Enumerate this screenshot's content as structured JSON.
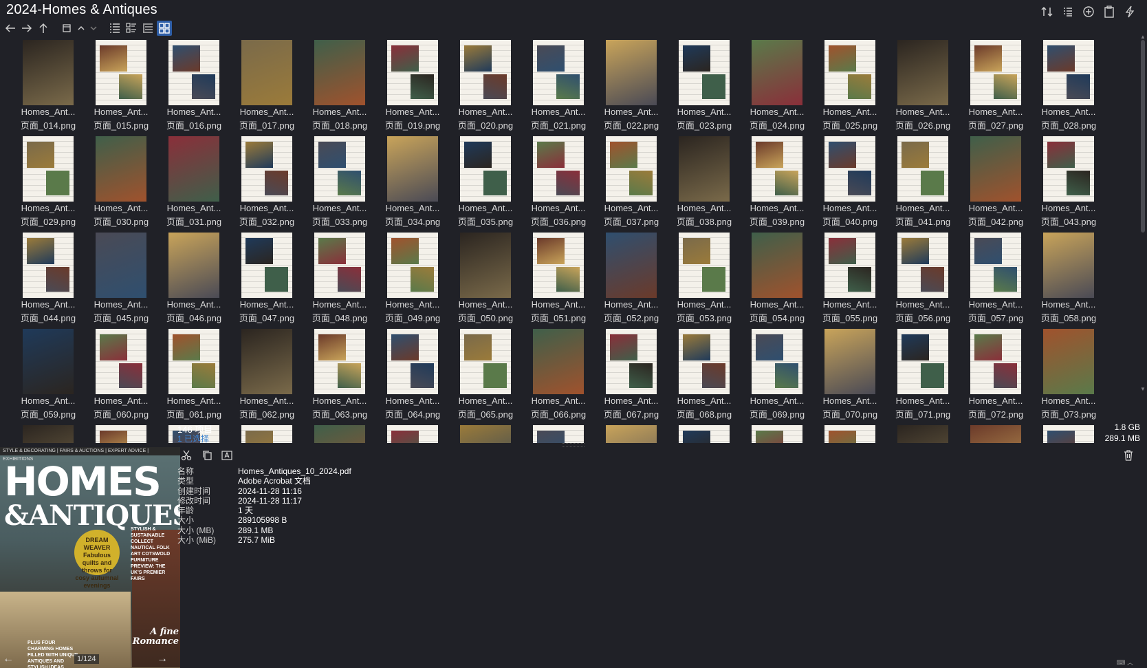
{
  "window": {
    "title": "2024-Homes & Antiques"
  },
  "top_actions": [
    {
      "name": "sort-icon"
    },
    {
      "name": "view-list-icon"
    },
    {
      "name": "add-icon"
    },
    {
      "name": "clipboard-icon"
    },
    {
      "name": "lightning-icon"
    }
  ],
  "toolbar": [
    {
      "name": "back-icon"
    },
    {
      "name": "forward-icon"
    },
    {
      "name": "up-icon"
    },
    {
      "name": "folder-icon"
    },
    {
      "name": "chevron-up-icon"
    },
    {
      "name": "chevron-down-icon"
    },
    {
      "name": "details-view-icon"
    },
    {
      "name": "tiles-view-icon"
    },
    {
      "name": "tree-view-icon"
    },
    {
      "name": "thumbnails-view-icon",
      "active": true
    }
  ],
  "files": [
    {
      "name": "Homes_Ant...",
      "page": "页面_014.png"
    },
    {
      "name": "Homes_Ant...",
      "page": "页面_015.png"
    },
    {
      "name": "Homes_Ant...",
      "page": "页面_016.png"
    },
    {
      "name": "Homes_Ant...",
      "page": "页面_017.png"
    },
    {
      "name": "Homes_Ant...",
      "page": "页面_018.png"
    },
    {
      "name": "Homes_Ant...",
      "page": "页面_019.png"
    },
    {
      "name": "Homes_Ant...",
      "page": "页面_020.png"
    },
    {
      "name": "Homes_Ant...",
      "page": "页面_021.png"
    },
    {
      "name": "Homes_Ant...",
      "page": "页面_022.png"
    },
    {
      "name": "Homes_Ant...",
      "page": "页面_023.png"
    },
    {
      "name": "Homes_Ant...",
      "page": "页面_024.png"
    },
    {
      "name": "Homes_Ant...",
      "page": "页面_025.png"
    },
    {
      "name": "Homes_Ant...",
      "page": "页面_026.png"
    },
    {
      "name": "Homes_Ant...",
      "page": "页面_027.png"
    },
    {
      "name": "Homes_Ant...",
      "page": "页面_028.png"
    },
    {
      "name": "Homes_Ant...",
      "page": "页面_029.png"
    },
    {
      "name": "Homes_Ant...",
      "page": "页面_030.png"
    },
    {
      "name": "Homes_Ant...",
      "page": "页面_031.png"
    },
    {
      "name": "Homes_Ant...",
      "page": "页面_032.png"
    },
    {
      "name": "Homes_Ant...",
      "page": "页面_033.png"
    },
    {
      "name": "Homes_Ant...",
      "page": "页面_034.png"
    },
    {
      "name": "Homes_Ant...",
      "page": "页面_035.png"
    },
    {
      "name": "Homes_Ant...",
      "page": "页面_036.png"
    },
    {
      "name": "Homes_Ant...",
      "page": "页面_037.png"
    },
    {
      "name": "Homes_Ant...",
      "page": "页面_038.png"
    },
    {
      "name": "Homes_Ant...",
      "page": "页面_039.png"
    },
    {
      "name": "Homes_Ant...",
      "page": "页面_040.png"
    },
    {
      "name": "Homes_Ant...",
      "page": "页面_041.png"
    },
    {
      "name": "Homes_Ant...",
      "page": "页面_042.png"
    },
    {
      "name": "Homes_Ant...",
      "page": "页面_043.png"
    },
    {
      "name": "Homes_Ant...",
      "page": "页面_044.png"
    },
    {
      "name": "Homes_Ant...",
      "page": "页面_045.png"
    },
    {
      "name": "Homes_Ant...",
      "page": "页面_046.png"
    },
    {
      "name": "Homes_Ant...",
      "page": "页面_047.png"
    },
    {
      "name": "Homes_Ant...",
      "page": "页面_048.png"
    },
    {
      "name": "Homes_Ant...",
      "page": "页面_049.png"
    },
    {
      "name": "Homes_Ant...",
      "page": "页面_050.png"
    },
    {
      "name": "Homes_Ant...",
      "page": "页面_051.png"
    },
    {
      "name": "Homes_Ant...",
      "page": "页面_052.png"
    },
    {
      "name": "Homes_Ant...",
      "page": "页面_053.png"
    },
    {
      "name": "Homes_Ant...",
      "page": "页面_054.png"
    },
    {
      "name": "Homes_Ant...",
      "page": "页面_055.png"
    },
    {
      "name": "Homes_Ant...",
      "page": "页面_056.png"
    },
    {
      "name": "Homes_Ant...",
      "page": "页面_057.png"
    },
    {
      "name": "Homes_Ant...",
      "page": "页面_058.png"
    },
    {
      "name": "Homes_Ant...",
      "page": "页面_059.png"
    },
    {
      "name": "Homes_Ant...",
      "page": "页面_060.png"
    },
    {
      "name": "Homes_Ant...",
      "page": "页面_061.png"
    },
    {
      "name": "Homes_Ant...",
      "page": "页面_062.png"
    },
    {
      "name": "Homes_Ant...",
      "page": "页面_063.png"
    },
    {
      "name": "Homes_Ant...",
      "page": "页面_064.png"
    },
    {
      "name": "Homes_Ant...",
      "page": "页面_065.png"
    },
    {
      "name": "Homes_Ant...",
      "page": "页面_066.png"
    },
    {
      "name": "Homes_Ant...",
      "page": "页面_067.png"
    },
    {
      "name": "Homes_Ant...",
      "page": "页面_068.png"
    },
    {
      "name": "Homes_Ant...",
      "page": "页面_069.png"
    },
    {
      "name": "Homes_Ant...",
      "page": "页面_070.png"
    },
    {
      "name": "Homes_Ant...",
      "page": "页面_071.png"
    },
    {
      "name": "Homes_Ant...",
      "page": "页面_072.png"
    },
    {
      "name": "Homes_Ant...",
      "page": "页面_073.png"
    },
    {
      "name": "",
      "page": ""
    },
    {
      "name": "",
      "page": ""
    },
    {
      "name": "",
      "page": ""
    },
    {
      "name": "",
      "page": ""
    },
    {
      "name": "",
      "page": ""
    },
    {
      "name": "",
      "page": ""
    },
    {
      "name": "",
      "page": ""
    },
    {
      "name": "",
      "page": ""
    },
    {
      "name": "",
      "page": ""
    },
    {
      "name": "",
      "page": ""
    },
    {
      "name": "",
      "page": ""
    },
    {
      "name": "",
      "page": ""
    },
    {
      "name": "",
      "page": ""
    },
    {
      "name": "",
      "page": ""
    },
    {
      "name": "",
      "page": ""
    }
  ],
  "thumb_palette": [
    "#2b2520",
    "#6b3a2a",
    "#2f4f6f",
    "#7a6a4a",
    "#3f5f4a",
    "#8a2f3a",
    "#9b7b3a",
    "#4a4a55",
    "#c9a45a",
    "#1f3a5a",
    "#5a7a4a",
    "#a0522d"
  ],
  "preview": {
    "cover_top_text": "STYLE & DECORATING | FAIRS & AUCTIONS | EXPERT ADVICE | EXHIBITIONS",
    "logo_line1": "HOMES",
    "logo_line2": "&ANTIQUES",
    "badge_text": "DREAM WEAVER Fabulous quilts and throws for cosy autumnal evenings",
    "side_text": "STYLISH & SUSTAINABLE COLLECT NAUTICAL FOLK ART COTSWOLD FURNITURE PREVIEW: THE UK'S PREMIER FAIRS",
    "romance_text": "A fine Romance",
    "plus_text": "PLUS FOUR CHARMING HOMES FILLED WITH UNIQUE ANTIQUES AND STYLISH IDEAS",
    "page_counter": "1/124",
    "prev_label": "←",
    "next_label": "→"
  },
  "details": {
    "item_count": "146 项目",
    "selected": "1 已选择",
    "total_size": "1.8 GB",
    "selected_size": "289.1 MB",
    "properties": [
      {
        "label": "名称",
        "value": "Homes_Antiques_10_2024.pdf"
      },
      {
        "label": "类型",
        "value": "Adobe Acrobat 文档"
      },
      {
        "label": "创建时间",
        "value": "2024-11-28  11:16"
      },
      {
        "label": "修改时间",
        "value": "2024-11-28  11:17"
      },
      {
        "label": "年龄",
        "value": "1 天"
      },
      {
        "label": "大小",
        "value": "289105998 B"
      },
      {
        "label": "大小 (MB)",
        "value": "289.1 MB"
      },
      {
        "label": "大小 (MiB)",
        "value": "275.7 MiB"
      }
    ]
  },
  "status": {
    "corner": "⌨  ︿"
  }
}
